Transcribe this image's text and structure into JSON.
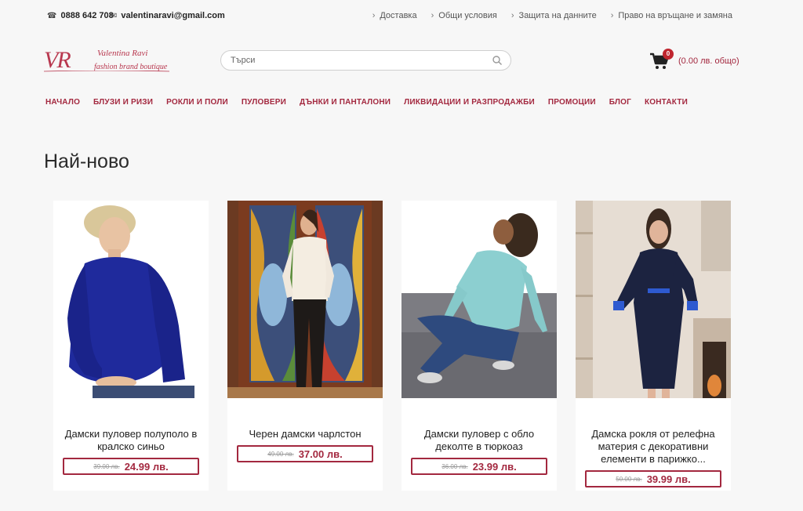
{
  "topbar": {
    "phone": "0888 642 708",
    "email": "valentinaravi@gmail.com",
    "links": [
      "Доставка",
      "Общи условия",
      "Защита на данните",
      "Право на връщане и замяна"
    ]
  },
  "header": {
    "logo_mono": "VR",
    "logo_name": "Valentina Ravi",
    "logo_tag": "fashion brand boutique",
    "search_placeholder": "Търси",
    "cart_count": "0",
    "cart_total": "(0.00 лв. общо)"
  },
  "nav": {
    "items": [
      "НАЧАЛО",
      "БЛУЗИ И РИЗИ",
      "РОКЛИ И ПОЛИ",
      "ПУЛОВЕРИ",
      "ДЪНКИ И ПАНТАЛОНИ",
      "ЛИКВИДАЦИИ И РАЗПРОДАЖБИ",
      "ПРОМОЦИИ",
      "БЛОГ",
      "КОНТАКТИ"
    ]
  },
  "main": {
    "title": "Най-ново",
    "products": [
      {
        "name": "Дамски пуловер полуполо в кралско синьо",
        "old_price": "39.00 лв.",
        "new_price": "24.99 лв."
      },
      {
        "name": "Черен дамски чарлстон",
        "old_price": "49.00 лв.",
        "new_price": "37.00 лв."
      },
      {
        "name": "Дамски пуловер с обло деколте в тюркоаз",
        "old_price": "36.00 лв.",
        "new_price": "23.99 лв."
      },
      {
        "name": "Дамска рокля от релефна материя с декоративни елементи в парижко...",
        "old_price": "50.00 лв.",
        "new_price": "39.99 лв."
      }
    ]
  },
  "colors": {
    "brand": "#a3283f",
    "badge": "#c0262f",
    "background": "#f7f7f7"
  }
}
